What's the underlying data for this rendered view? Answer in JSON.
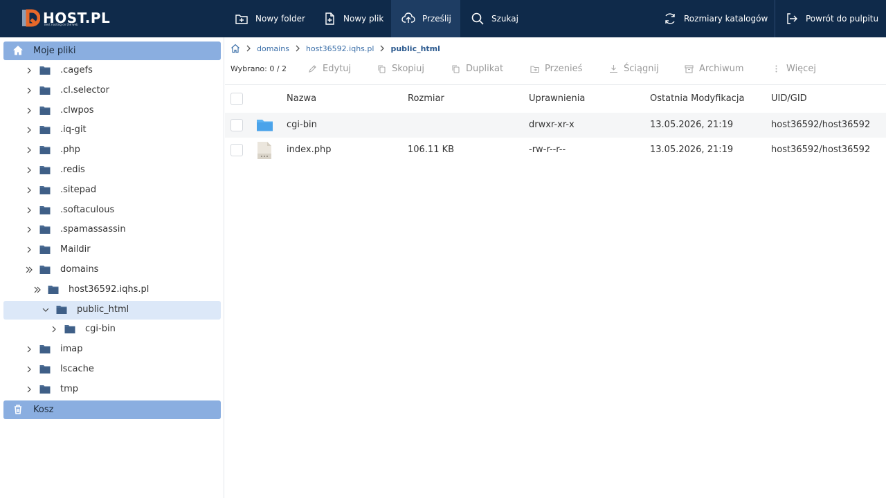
{
  "topbar": {
    "logo_text": "HOST.PL",
    "logo_tagline": "Best hosting on the web",
    "buttons": [
      {
        "label": "Nowy folder",
        "icon": "new-folder-icon"
      },
      {
        "label": "Nowy plik",
        "icon": "new-file-icon"
      },
      {
        "label": "Prześlij",
        "icon": "upload-cloud-icon",
        "active": true
      },
      {
        "label": "Szukaj",
        "icon": "search-icon"
      },
      {
        "label": "Rozmiary katalogów",
        "icon": "refresh-icon"
      },
      {
        "label": "Powrót do pulpitu",
        "icon": "sign-out-icon"
      }
    ]
  },
  "sidebar": {
    "home_label": "Moje pliki",
    "trash_label": "Kosz",
    "tree": [
      {
        "label": ".cagefs"
      },
      {
        "label": ".cl.selector"
      },
      {
        "label": ".clwpos"
      },
      {
        "label": ".iq-git"
      },
      {
        "label": ".php"
      },
      {
        "label": ".redis"
      },
      {
        "label": ".sitepad"
      },
      {
        "label": ".softaculous"
      },
      {
        "label": ".spamassassin"
      },
      {
        "label": "Maildir"
      },
      {
        "label": "domains"
      },
      {
        "label": "host36592.iqhs.pl"
      },
      {
        "label": "public_html",
        "selected": true
      },
      {
        "label": "cgi-bin"
      },
      {
        "label": "imap"
      },
      {
        "label": "lscache"
      },
      {
        "label": "tmp"
      }
    ]
  },
  "breadcrumb": [
    "domains",
    "host36592.iqhs.pl",
    "public_html"
  ],
  "toolbar": {
    "selected_count": "Wybrano: 0 / 2",
    "actions": [
      "Edytuj",
      "Skopiuj",
      "Duplikat",
      "Przenieś",
      "Ściągnij",
      "Archiwum",
      "Więcej"
    ]
  },
  "table": {
    "columns": [
      "Nazwa",
      "Rozmiar",
      "Uprawnienia",
      "Ostatnia Modyfikacja",
      "UID/GID"
    ],
    "rows": [
      {
        "name": "cgi-bin",
        "type": "folder",
        "size": "",
        "perms": "drwxr-xr-x",
        "modified": "13.05.2026, 21:19",
        "owner": "host36592/host36592"
      },
      {
        "name": "index.php",
        "type": "file",
        "size": "106.11 KB",
        "perms": "-rw-r--r--",
        "modified": "13.05.2026, 21:19",
        "owner": "host36592/host36592"
      }
    ]
  },
  "colors": {
    "topbar": "#0f2a4a",
    "accent": "#8aaee0",
    "selected": "#dce8f8",
    "folder": "#4a6b93",
    "folder_light": "#5db3f2",
    "logo_orange": "#e8682a"
  }
}
